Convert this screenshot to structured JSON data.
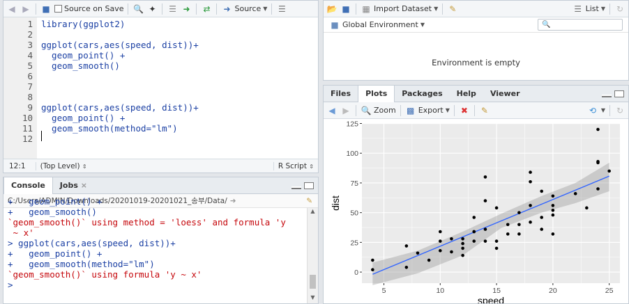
{
  "editor": {
    "toolbar": {
      "source_on_save": "Source on Save",
      "source": "Source"
    },
    "lines": [
      {
        "num": "1",
        "text": "library(ggplot2)"
      },
      {
        "num": "2",
        "text": ""
      },
      {
        "num": "3",
        "text": "ggplot(cars,aes(speed, dist))+"
      },
      {
        "num": "4",
        "text": "  geom_point() +"
      },
      {
        "num": "5",
        "text": "  geom_smooth()"
      },
      {
        "num": "6",
        "text": ""
      },
      {
        "num": "7",
        "text": ""
      },
      {
        "num": "8",
        "text": ""
      },
      {
        "num": "9",
        "text": "ggplot(cars,aes(speed, dist))+"
      },
      {
        "num": "10",
        "text": "  geom_point() +"
      },
      {
        "num": "11",
        "text": "  geom_smooth(method=\"lm\")"
      },
      {
        "num": "12",
        "text": ""
      }
    ],
    "status": {
      "position": "12:1",
      "scope": "(Top Level)",
      "filetype": "R Script"
    }
  },
  "console": {
    "tabs": [
      "Console",
      "Jobs"
    ],
    "path": "C:/Users/ADMIN/Downloads/20201019-20201021_송부/Data/",
    "lines": [
      {
        "text": "+   geom_point() +",
        "kind": "in"
      },
      {
        "text": "+   geom_smooth()",
        "kind": "in"
      },
      {
        "text": "`geom_smooth()` using method = 'loess' and formula 'y",
        "kind": "msg"
      },
      {
        "text": " ~ x'",
        "kind": "msg"
      },
      {
        "text": "> ggplot(cars,aes(speed, dist))+",
        "kind": "in"
      },
      {
        "text": "+   geom_point() +",
        "kind": "in"
      },
      {
        "text": "+   geom_smooth(method=\"lm\")",
        "kind": "in"
      },
      {
        "text": "`geom_smooth()` using formula 'y ~ x'",
        "kind": "msg"
      },
      {
        "text": "> ",
        "kind": "in"
      }
    ]
  },
  "environment": {
    "toolbar": {
      "import_dataset": "Import Dataset",
      "list": "List"
    },
    "global_env": "Global Environment",
    "empty_text": "Environment is empty"
  },
  "viewer": {
    "tabs": [
      "Files",
      "Plots",
      "Packages",
      "Help",
      "Viewer"
    ],
    "toolbar": {
      "zoom": "Zoom",
      "export": "Export"
    }
  },
  "chart_data": {
    "type": "scatter",
    "xlabel": "speed",
    "ylabel": "dist",
    "xlim": [
      3.05,
      25.95
    ],
    "ylim": [
      -9.3,
      125.3
    ],
    "xticks": [
      5,
      10,
      15,
      20,
      25
    ],
    "yticks": [
      0,
      25,
      50,
      75,
      100,
      125
    ],
    "grid": true,
    "x": [
      4,
      4,
      7,
      7,
      8,
      9,
      10,
      10,
      10,
      11,
      11,
      12,
      12,
      12,
      12,
      13,
      13,
      13,
      13,
      14,
      14,
      14,
      14,
      15,
      15,
      15,
      16,
      16,
      17,
      17,
      17,
      18,
      18,
      18,
      18,
      19,
      19,
      19,
      20,
      20,
      20,
      20,
      20,
      22,
      23,
      24,
      24,
      24,
      24,
      25
    ],
    "y": [
      2,
      10,
      4,
      22,
      16,
      10,
      18,
      26,
      34,
      17,
      28,
      14,
      20,
      24,
      28,
      26,
      34,
      34,
      46,
      26,
      36,
      60,
      80,
      20,
      26,
      54,
      32,
      40,
      32,
      40,
      50,
      42,
      56,
      76,
      84,
      36,
      46,
      68,
      32,
      48,
      52,
      56,
      64,
      66,
      54,
      70,
      92,
      93,
      120,
      85
    ],
    "fit": {
      "x": [
        4,
        25
      ],
      "y": [
        -1.85,
        80.73
      ]
    },
    "ci": {
      "x": [
        4,
        8,
        12,
        15.4,
        19,
        22,
        25
      ],
      "lower": [
        -11,
        -1,
        14,
        37,
        50,
        58,
        68
      ],
      "upper": [
        8,
        18,
        34,
        49,
        64,
        75,
        92
      ]
    },
    "colors": {
      "panel": "#ebebeb",
      "grid": "#ffffff",
      "line": "#3366ff",
      "ribbon": "#999999",
      "point": "#000000"
    }
  }
}
